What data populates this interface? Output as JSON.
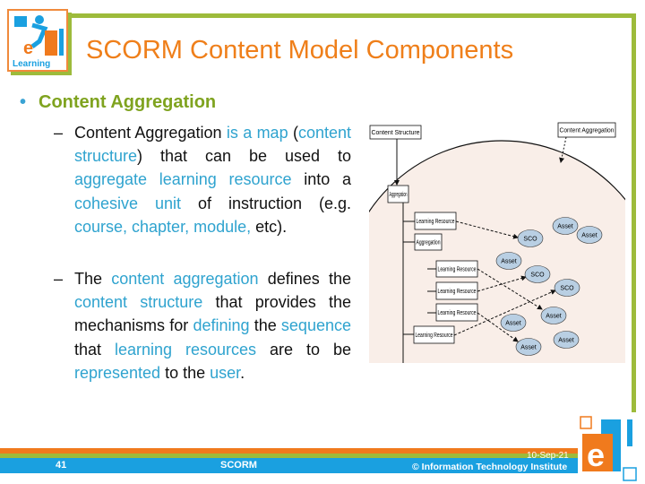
{
  "title": "SCORM Content Model Components",
  "logo": {
    "text": "eITI Learning"
  },
  "bullet": {
    "heading": "Content Aggregation"
  },
  "paragraphs": [
    [
      {
        "t": "Content Aggregation ",
        "hl": false
      },
      {
        "t": "is a map",
        "hl": true
      },
      {
        "t": " (",
        "hl": false
      },
      {
        "t": "content structure",
        "hl": true
      },
      {
        "t": ") that can be used to ",
        "hl": false
      },
      {
        "t": "aggregate learning resource",
        "hl": true
      },
      {
        "t": " into a ",
        "hl": false
      },
      {
        "t": "cohesive unit",
        "hl": true
      },
      {
        "t": " of instruction (e.g. ",
        "hl": false
      },
      {
        "t": "course, chapter, module,",
        "hl": true
      },
      {
        "t": " etc).",
        "hl": false
      }
    ],
    [
      {
        "t": "The ",
        "hl": false
      },
      {
        "t": "content aggregation",
        "hl": true
      },
      {
        "t": " defines the ",
        "hl": false
      },
      {
        "t": "content structure",
        "hl": true
      },
      {
        "t": " that provides the mechanisms for ",
        "hl": false
      },
      {
        "t": "defining",
        "hl": true
      },
      {
        "t": " the ",
        "hl": false
      },
      {
        "t": "sequence",
        "hl": true
      },
      {
        "t": " that ",
        "hl": false
      },
      {
        "t": "learning resources",
        "hl": true
      },
      {
        "t": " are to be ",
        "hl": false
      },
      {
        "t": "represented",
        "hl": true
      },
      {
        "t": " to the ",
        "hl": false
      },
      {
        "t": "user",
        "hl": true
      },
      {
        "t": ".",
        "hl": false
      }
    ]
  ],
  "diagram": {
    "content_structure": "Content Structure",
    "content_aggregation": "Content Aggregation",
    "aggregation": "Aggregation",
    "aggregation2": "Aggregation",
    "learning_resource": "Learning Resource",
    "asset": "Asset",
    "sco": "SCO"
  },
  "footer": {
    "page": "41",
    "topic": "SCORM",
    "date": "10-Sep-21",
    "copyright": "© Information Technology Institute"
  },
  "colors": {
    "title": "#ef7f1a",
    "heading": "#7fa31f",
    "highlight": "#2fa3cf",
    "frame": "#9dbb3b",
    "footer_blue": "#1aa0e0",
    "footer_orange": "#f07a1d"
  }
}
